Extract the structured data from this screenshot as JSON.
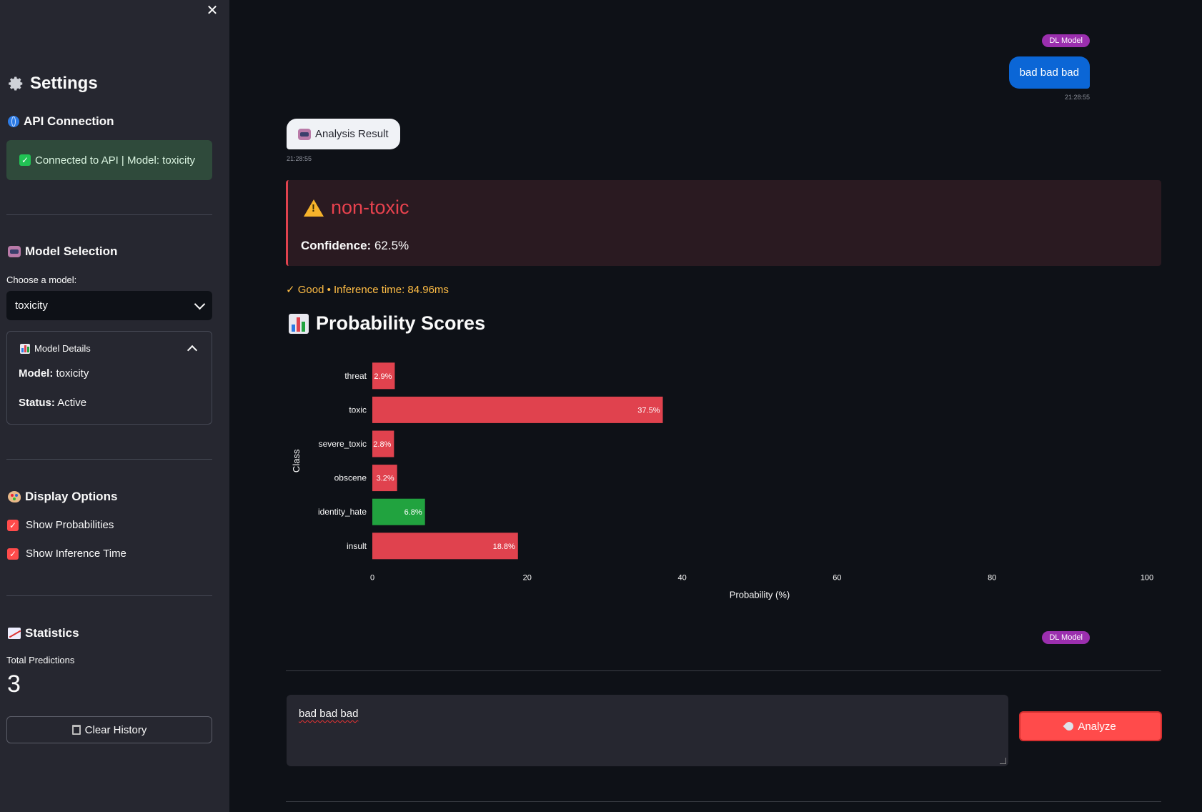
{
  "sidebar": {
    "close_glyph": "✕",
    "title": "Settings",
    "api": {
      "heading": "API Connection",
      "status_text": "Connected to API | Model: toxicity"
    },
    "model_selection": {
      "heading": "Model Selection",
      "select_label": "Choose a model:",
      "selected_model": "toxicity",
      "details": {
        "title": "Model Details",
        "model_label": "Model:",
        "model_value": "toxicity",
        "status_label": "Status:",
        "status_value": "Active"
      }
    },
    "display_options": {
      "heading": "Display Options",
      "show_probabilities": "Show Probabilities",
      "show_inference_time": "Show Inference Time"
    },
    "statistics": {
      "heading": "Statistics",
      "total_label": "Total Predictions",
      "total_value": "3",
      "clear_button": "Clear History"
    }
  },
  "chat": {
    "badge_top": "DL Model",
    "user_message": "bad bad bad",
    "user_time": "21:28:55",
    "bot_label": "Analysis Result",
    "bot_time": "21:28:55",
    "result": {
      "label": "non-toxic",
      "confidence_label": "Confidence:",
      "confidence_value": "62.5%"
    },
    "inference_text": "✓ Good • Inference time: 84.96ms",
    "prob_title": "Probability Scores",
    "badge_bottom": "DL Model"
  },
  "input": {
    "value": "bad bad bad",
    "analyze_button": "Analyze"
  },
  "colors": {
    "accent": "#ff4b4b",
    "toxic_bar": "#e0424e",
    "safe_bar": "#21a33f",
    "user_bubble": "#0b66d6",
    "badge": "#9b2fae"
  },
  "chart_data": {
    "type": "bar",
    "orientation": "horizontal",
    "categories": [
      "threat",
      "toxic",
      "severe_toxic",
      "obscene",
      "identity_hate",
      "insult"
    ],
    "values": [
      2.9,
      37.5,
      2.8,
      3.2,
      6.8,
      18.8
    ],
    "labels": [
      "2.9%",
      "37.5%",
      "2.8%",
      "3.2%",
      "6.8%",
      "18.8%"
    ],
    "highlight": [
      "toxic",
      "toxic",
      "toxic",
      "toxic",
      "safe",
      "toxic"
    ],
    "xlabel": "Probability (%)",
    "ylabel": "Class",
    "xlim": [
      0,
      100
    ],
    "xticks": [
      0,
      20,
      40,
      60,
      80,
      100
    ]
  }
}
